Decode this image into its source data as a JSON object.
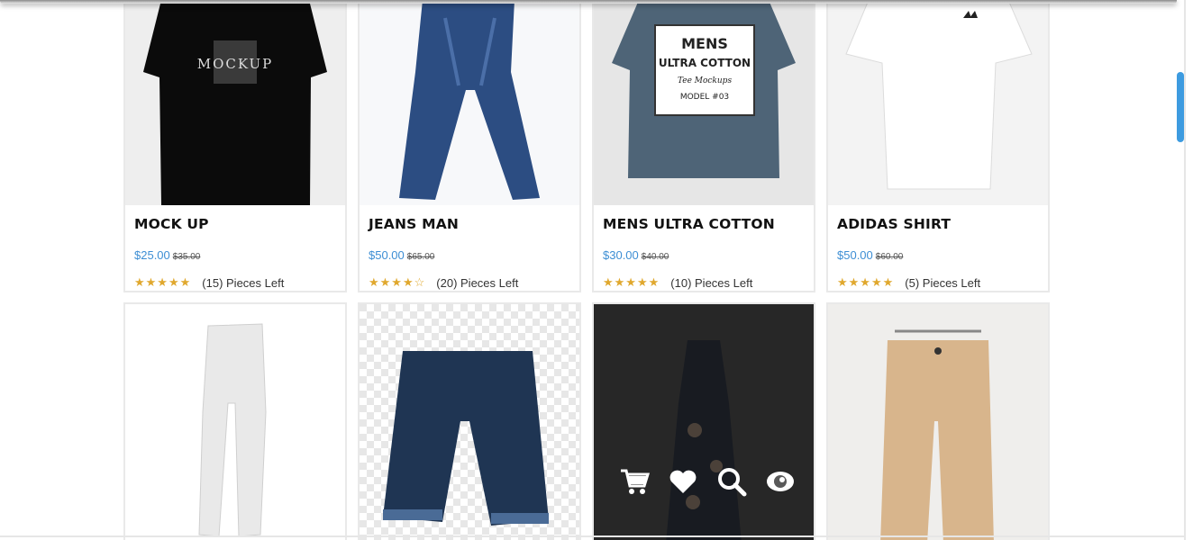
{
  "products": [
    {
      "title": "MOCK UP",
      "price": "$25.00",
      "old_price": "$35.00",
      "stars": "★★★★★",
      "stock": "(15) Pieces Left",
      "image_text": "MOCKUP"
    },
    {
      "title": "JEANS MAN",
      "price": "$50.00",
      "old_price": "$65.00",
      "stars": "★★★★☆",
      "stock": "(20) Pieces Left"
    },
    {
      "title": "MENS ULTRA COTTON",
      "price": "$30.00",
      "old_price": "$40.00",
      "stars": "★★★★★",
      "stock": "(10) Pieces Left",
      "image_text_1": "MENS",
      "image_text_2": "ULTRA COTTON",
      "image_text_3": "Tee Mockups",
      "image_text_4": "MODEL #03"
    },
    {
      "title": "ADIDAS SHIRT",
      "price": "$50.00",
      "old_price": "$60.00",
      "stars": "★★★★★",
      "stock": "(5) Pieces Left"
    }
  ],
  "second_row": [
    {
      "image": "white-pants"
    },
    {
      "image": "denim-shorts"
    },
    {
      "image": "floral-dress",
      "hover_actions": [
        "cart-icon",
        "heart-icon",
        "search-icon",
        "eye-icon"
      ]
    },
    {
      "image": "beige-pants"
    }
  ],
  "colors": {
    "accent": "#3d8ed4",
    "star": "#e0a82e",
    "scrollbar": "#3d9be0"
  }
}
